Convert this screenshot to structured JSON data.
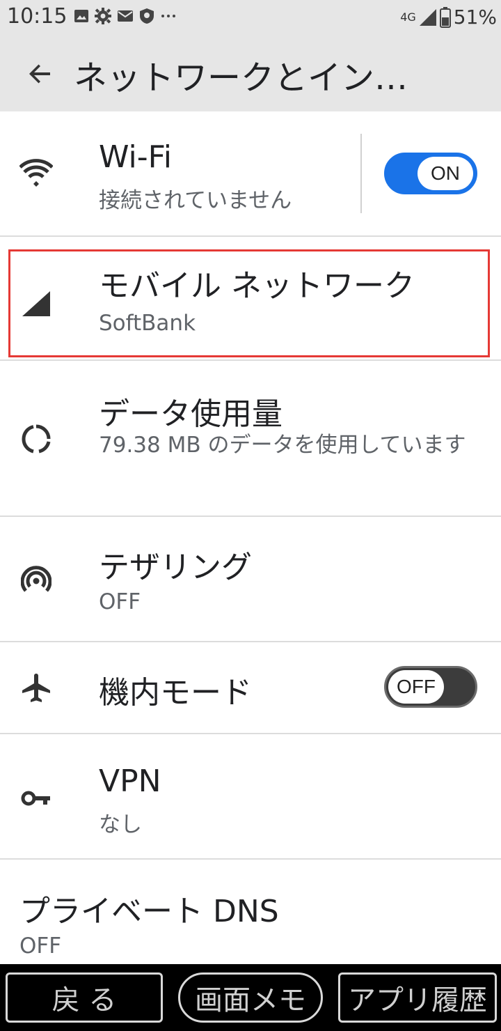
{
  "status_bar": {
    "time": "10:15",
    "network": "4G",
    "battery": "51%"
  },
  "app_bar": {
    "title": "ネットワークとイン…"
  },
  "items": {
    "wifi": {
      "title": "Wi-Fi",
      "subtitle": "接続されていません",
      "toggle": "ON",
      "icon": "wifi-icon"
    },
    "mobile": {
      "title": "モバイル ネットワーク",
      "subtitle": "SoftBank",
      "icon": "signal-icon"
    },
    "data": {
      "title": "データ使用量",
      "subtitle": "79.38 MB のデータを使用しています",
      "icon": "data-usage-icon"
    },
    "tethering": {
      "title": "テザリング",
      "subtitle": "OFF",
      "icon": "hotspot-icon"
    },
    "airplane": {
      "title": "機内モード",
      "toggle": "OFF",
      "icon": "airplane-icon"
    },
    "vpn": {
      "title": "VPN",
      "subtitle": "なし",
      "icon": "key-icon"
    },
    "dns": {
      "title": "プライベート DNS",
      "subtitle": "OFF"
    }
  },
  "bottom_nav": {
    "back": "戻 る",
    "memo": "画面メモ",
    "recent": "アプリ履歴"
  },
  "colors": {
    "accent": "#1a73e8",
    "highlight": "#e53935",
    "bar_background": "#e6e6e6"
  }
}
